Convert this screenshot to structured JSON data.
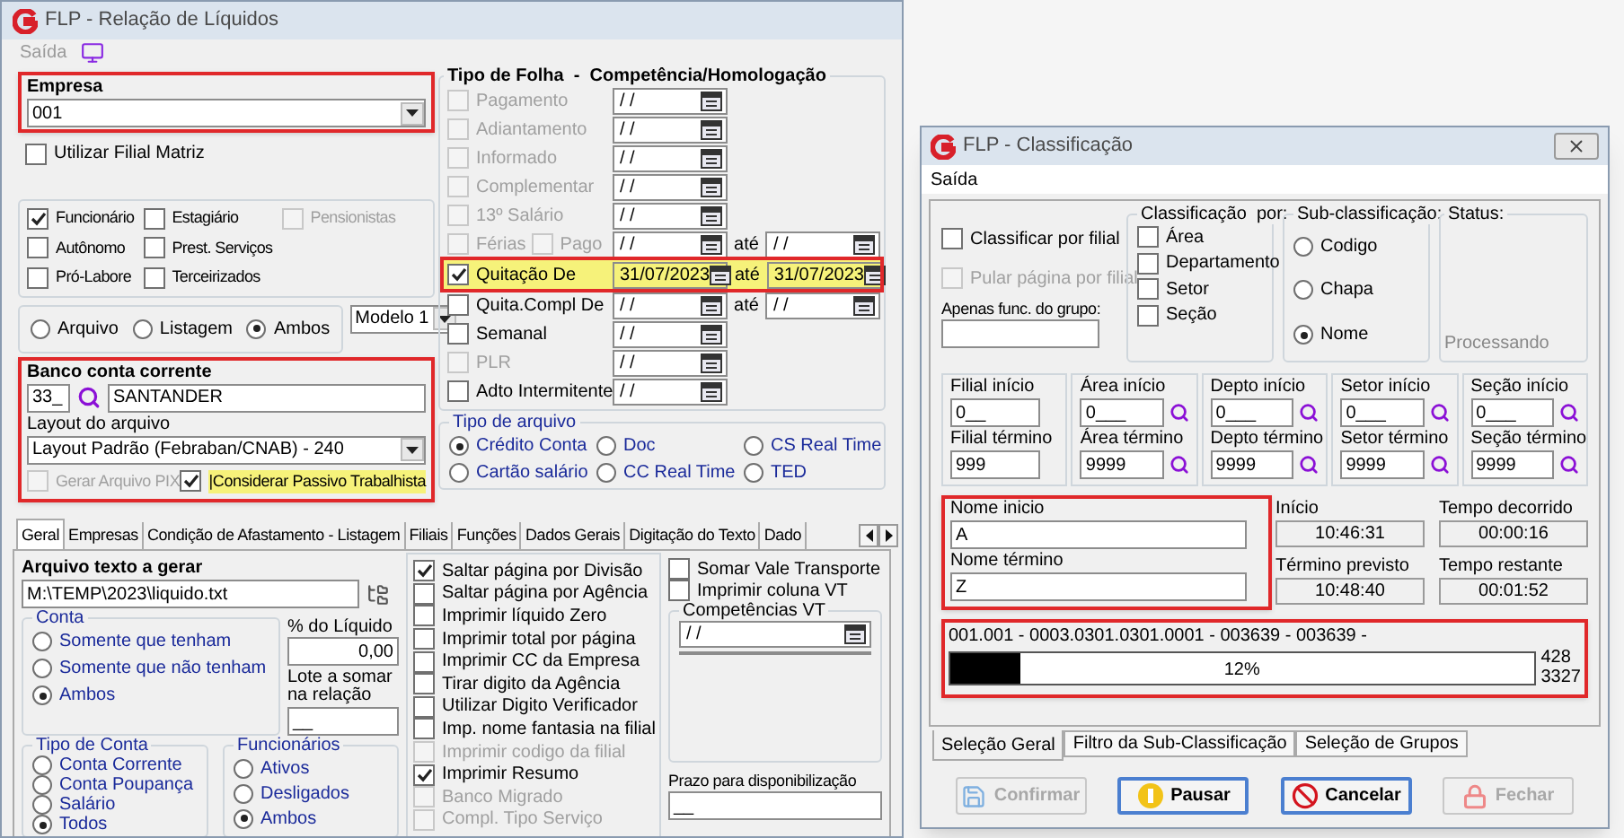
{
  "main_window": {
    "title": "FLP - Relação de Líquidos",
    "menu": [
      {
        "label": "Saída"
      }
    ],
    "empresa": {
      "label": "Empresa",
      "value": "001"
    },
    "filial_matriz": {
      "label": "Utilizar Filial Matriz",
      "checked": false
    },
    "tipos": [
      {
        "label": "Funcionário",
        "checked": true,
        "disabled": false
      },
      {
        "label": "Autônomo",
        "checked": false,
        "disabled": false
      },
      {
        "label": "Pró-Labore",
        "checked": false,
        "disabled": false
      },
      {
        "label": "Estagiário",
        "checked": false,
        "disabled": false
      },
      {
        "label": "Prest. Serviços",
        "checked": false,
        "disabled": false
      },
      {
        "label": "Terceirizados",
        "checked": false,
        "disabled": false
      },
      {
        "label": "Pensionistas",
        "checked": false,
        "disabled": true
      }
    ],
    "modo": [
      {
        "label": "Arquivo",
        "selected": false
      },
      {
        "label": "Listagem",
        "selected": false
      },
      {
        "label": "Ambos",
        "selected": true
      }
    ],
    "modelo": "Modelo 1",
    "banco": {
      "label": "Banco conta corrente",
      "code": "33_",
      "name": "SANTANDER",
      "layout_label": "Layout do arquivo",
      "layout": "Layout Padrão (Febraban/CNAB) - 240"
    },
    "extra_options": [
      {
        "label": "Gerar Arquivo PIX",
        "checked": false,
        "disabled": true,
        "highlighted": false
      },
      {
        "label": "|Considerar Passivo Trabalhista",
        "checked": true,
        "disabled": false,
        "highlighted": true
      }
    ],
    "tipo_folha": {
      "title": "Tipo de Folha  -  Competência/Homologação",
      "rows": [
        {
          "label": "Pagamento",
          "checked": false,
          "disabled": true,
          "highlighted": false,
          "date": "/ /"
        },
        {
          "label": "Adiantamento",
          "checked": false,
          "disabled": true,
          "highlighted": false,
          "date": "/ /"
        },
        {
          "label": "Informado",
          "checked": false,
          "disabled": true,
          "highlighted": false,
          "date": "/ /"
        },
        {
          "label": "Complementar",
          "checked": false,
          "disabled": true,
          "highlighted": false,
          "date": "/ /"
        },
        {
          "label": "13º Salário",
          "checked": false,
          "disabled": true,
          "highlighted": false,
          "date": "/ /"
        },
        {
          "label": "Férias",
          "checked": false,
          "disabled": true,
          "highlighted": false,
          "date": "/ /",
          "pago": {
            "label": "Pago",
            "checked": false
          },
          "until_label": "até",
          "until": "/ /"
        },
        {
          "label": "Quitação De",
          "checked": true,
          "disabled": false,
          "highlighted": true,
          "date": "31/07/2023",
          "until_label": "até",
          "until": "31/07/2023"
        },
        {
          "label": "Quita.Compl De",
          "checked": false,
          "disabled": false,
          "highlighted": false,
          "date": "/ /",
          "until_label": "até",
          "until": "/ /"
        },
        {
          "label": "Semanal",
          "checked": false,
          "disabled": false,
          "highlighted": false,
          "date": "/ /"
        },
        {
          "label": "PLR",
          "checked": false,
          "disabled": true,
          "highlighted": false,
          "date": "/ /"
        },
        {
          "label": "Adto Intermitente",
          "checked": false,
          "disabled": false,
          "highlighted": false,
          "date": "/ /"
        }
      ]
    },
    "tipo_arquivo": {
      "title": "Tipo de arquivo",
      "options": [
        {
          "label": "Crédito Conta",
          "selected": true
        },
        {
          "label": "Doc",
          "selected": false
        },
        {
          "label": "CS Real Time",
          "selected": false
        },
        {
          "label": "Cartão salário",
          "selected": false
        },
        {
          "label": "CC Real Time",
          "selected": false
        },
        {
          "label": "TED",
          "selected": false
        }
      ]
    },
    "tabs": [
      {
        "label": "Geral",
        "selected": true
      },
      {
        "label": "Empresas",
        "selected": false
      },
      {
        "label": "Condição de Afastamento - Listagem",
        "selected": false
      },
      {
        "label": "Filiais",
        "selected": false
      },
      {
        "label": "Funções",
        "selected": false
      },
      {
        "label": "Dados Gerais",
        "selected": false
      },
      {
        "label": "Digitação do Texto",
        "selected": false
      },
      {
        "label": "Dado",
        "selected": false
      }
    ],
    "geral": {
      "arquivo": {
        "label": "Arquivo texto a gerar",
        "value": "M:\\TEMP\\2023\\liquido.txt"
      },
      "conta": {
        "title": "Conta",
        "options": [
          {
            "label": "Somente que tenham",
            "selected": false
          },
          {
            "label": "Somente que não tenham",
            "selected": false
          },
          {
            "label": "Ambos",
            "selected": true
          }
        ]
      },
      "percentual": {
        "label": "% do Líquido",
        "value": "0,00"
      },
      "lote": {
        "label": "Lote a somar na relação",
        "value": "__"
      },
      "tipo_conta": {
        "title": "Tipo de Conta",
        "options": [
          {
            "label": "Conta Corrente",
            "selected": false
          },
          {
            "label": "Conta Poupança",
            "selected": false
          },
          {
            "label": "Salário",
            "selected": false
          },
          {
            "label": "Todos",
            "selected": true
          }
        ]
      },
      "funcionarios": {
        "title": "Funcionários",
        "options": [
          {
            "label": "Ativos",
            "selected": false
          },
          {
            "label": "Desligados",
            "selected": false
          },
          {
            "label": "Ambos",
            "selected": true
          }
        ]
      },
      "flags": [
        {
          "label": "Saltar página por Divisão",
          "checked": true,
          "disabled": false
        },
        {
          "label": "Saltar página por Agência",
          "checked": false,
          "disabled": false
        },
        {
          "label": "Imprimir líquido Zero",
          "checked": false,
          "disabled": false
        },
        {
          "label": "Imprimir total por página",
          "checked": false,
          "disabled": false
        },
        {
          "label": "Imprimir CC da Empresa",
          "checked": false,
          "disabled": false
        },
        {
          "label": "Tirar digito da Agência",
          "checked": false,
          "disabled": false
        },
        {
          "label": "Utilizar Digito Verificador",
          "checked": false,
          "disabled": false
        },
        {
          "label": "Imp. nome fantasia na filial",
          "checked": false,
          "disabled": false
        },
        {
          "label": "Imprimir codigo da filial",
          "checked": false,
          "disabled": true
        },
        {
          "label": "Imprimir Resumo",
          "checked": true,
          "disabled": false
        },
        {
          "label": "Banco Migrado",
          "checked": false,
          "disabled": true
        },
        {
          "label": "Compl. Tipo Serviço",
          "checked": false,
          "disabled": true
        }
      ],
      "vt_options": [
        {
          "label": "Somar Vale Transporte",
          "checked": false
        },
        {
          "label": "Imprimir coluna VT",
          "checked": false
        }
      ],
      "competencias_vt": {
        "title": "Competências VT",
        "date": "/ /"
      },
      "prazo": {
        "label": "Prazo para disponibilização",
        "value": "__"
      }
    }
  },
  "class_window": {
    "title": "FLP - Classificação",
    "menu": [
      {
        "label": "Saída"
      }
    ],
    "checks": [
      {
        "label": "Classificar por filial",
        "checked": false,
        "disabled": false
      },
      {
        "label": "Pular página por filial",
        "checked": false,
        "disabled": true
      }
    ],
    "grupo": {
      "label": "Apenas func. do grupo:"
    },
    "classificacao": {
      "title": "Classificação  por:",
      "options": [
        {
          "label": "Área",
          "checked": false
        },
        {
          "label": "Departamento",
          "checked": false
        },
        {
          "label": "Setor",
          "checked": false
        },
        {
          "label": "Seção",
          "checked": false
        }
      ]
    },
    "sub_classificacao": {
      "title": "Sub-classificação:",
      "options": [
        {
          "label": "Codigo",
          "selected": false
        },
        {
          "label": "Chapa",
          "selected": false
        },
        {
          "label": "Nome",
          "selected": true
        }
      ]
    },
    "status": {
      "title": "Status:",
      "text": "Processando"
    },
    "ranges": [
      {
        "start_label": "Filial início",
        "start": "0__",
        "end_label": "Filial término",
        "end": "999",
        "search": false
      },
      {
        "start_label": "Área início",
        "start": "0___",
        "end_label": "Área término",
        "end": "9999",
        "search": true
      },
      {
        "start_label": "Depto início",
        "start": "0___",
        "end_label": "Depto término",
        "end": "9999",
        "search": true
      },
      {
        "start_label": "Setor início",
        "start": "0___",
        "end_label": "Setor término",
        "end": "9999",
        "search": true
      },
      {
        "start_label": "Seção início",
        "start": "0___",
        "end_label": "Seção término",
        "end": "9999",
        "search": true
      }
    ],
    "nome": {
      "start_label": "Nome inicio",
      "start": "A",
      "end_label": "Nome término",
      "end": "Z"
    },
    "timings": [
      {
        "label": "Início",
        "value": "10:46:31"
      },
      {
        "label": "Tempo decorrido",
        "value": "00:00:16"
      },
      {
        "label": "Término previsto",
        "value": "10:48:40"
      },
      {
        "label": "Tempo restante",
        "value": "00:01:52"
      }
    ],
    "progress": {
      "record": "001.001 - 0003.0301.0301.0001 - 003639 - 003639 -",
      "level": 0.12,
      "percent": "12%",
      "current": "428",
      "total": "3327"
    },
    "tabs": [
      {
        "label": "Seleção Geral",
        "selected": true
      },
      {
        "label": "Filtro da Sub-Classificação",
        "selected": false
      },
      {
        "label": "Seleção de Grupos",
        "selected": false
      }
    ],
    "buttons": [
      {
        "label": "Confirmar",
        "kind": "save",
        "disabled": true
      },
      {
        "label": "Pausar",
        "kind": "pause",
        "disabled": false
      },
      {
        "label": "Cancelar",
        "kind": "cancel",
        "disabled": false
      },
      {
        "label": "Fechar",
        "kind": "lock",
        "disabled": true
      }
    ]
  }
}
